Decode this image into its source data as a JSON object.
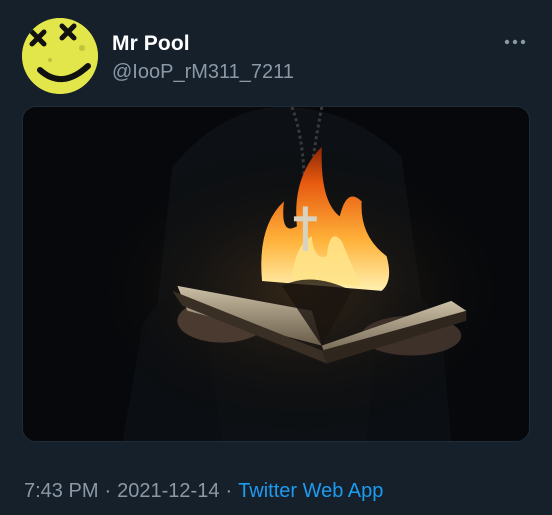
{
  "tweet": {
    "display_name": "Mr Pool",
    "handle": "@IooP_rM311_7211",
    "time": "7:43 PM",
    "separator": "·",
    "date": "2021-12-14",
    "source": "Twitter Web App"
  },
  "icons": {
    "more": "more-options-icon",
    "avatar": "smiley-face-avatar",
    "media": "burning-book-photo"
  },
  "colors": {
    "background": "#15202b",
    "secondary_text": "#8b98a5",
    "link": "#1d9bf0",
    "avatar_yellow": "#e6e84a"
  }
}
